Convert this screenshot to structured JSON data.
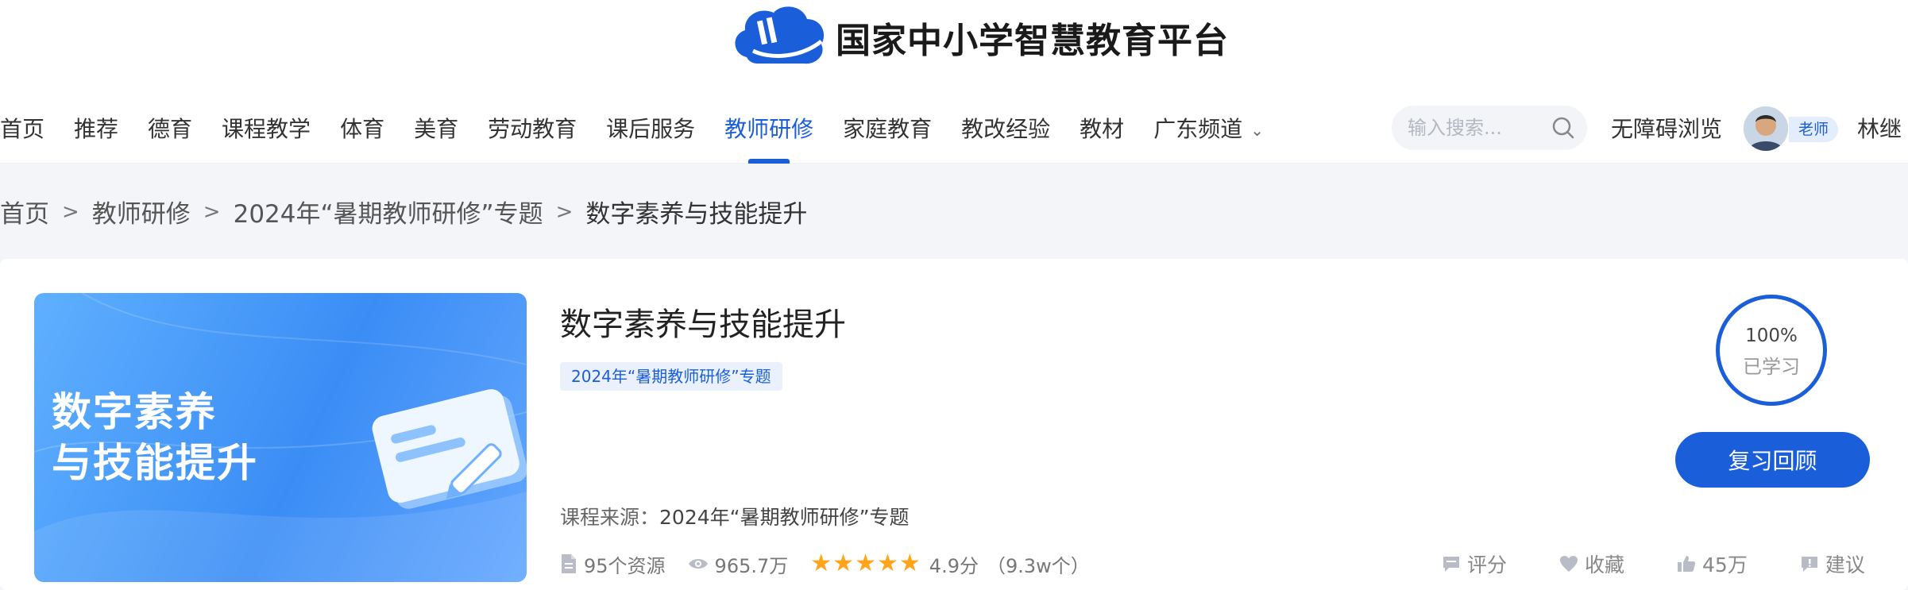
{
  "header": {
    "site_name": "国家中小学智慧教育平台"
  },
  "nav": {
    "items": [
      {
        "label": "首页"
      },
      {
        "label": "推荐"
      },
      {
        "label": "德育"
      },
      {
        "label": "课程教学"
      },
      {
        "label": "体育"
      },
      {
        "label": "美育"
      },
      {
        "label": "劳动教育"
      },
      {
        "label": "课后服务"
      },
      {
        "label": "教师研修",
        "active": true
      },
      {
        "label": "家庭教育"
      },
      {
        "label": "教改经验"
      },
      {
        "label": "教材"
      },
      {
        "label": "广东频道",
        "dropdown": true
      }
    ],
    "search_placeholder": "输入搜索...",
    "accessibility_label": "无障碍浏览",
    "user": {
      "role": "老师",
      "name": "林继"
    }
  },
  "breadcrumb": {
    "items": [
      "首页",
      "教师研修",
      "2024年“暑期教师研修”专题"
    ],
    "current": "数字素养与技能提升",
    "separator": ">"
  },
  "course": {
    "cover_lines": [
      "数字素养",
      "与技能提升"
    ],
    "title": "数字素养与技能提升",
    "tag": "2024年“暑期教师研修”专题",
    "source_label": "课程来源：",
    "source_value": "2024年“暑期教师研修”专题",
    "resources": "95个资源",
    "views": "965.7万",
    "rating_stars": 5,
    "score": "4.9分",
    "rating_count": "（9.3w个）",
    "progress": {
      "percent_text": "100%",
      "status": "已学习",
      "value": 1.0
    },
    "review_button": "复习回顾",
    "actions": {
      "rate": "评分",
      "favorite": "收藏",
      "likes": "45万",
      "suggest": "建议"
    }
  },
  "colors": {
    "accent": "#1a5ed9",
    "star": "#ffa41b",
    "page_bg": "#f3f5f9"
  }
}
